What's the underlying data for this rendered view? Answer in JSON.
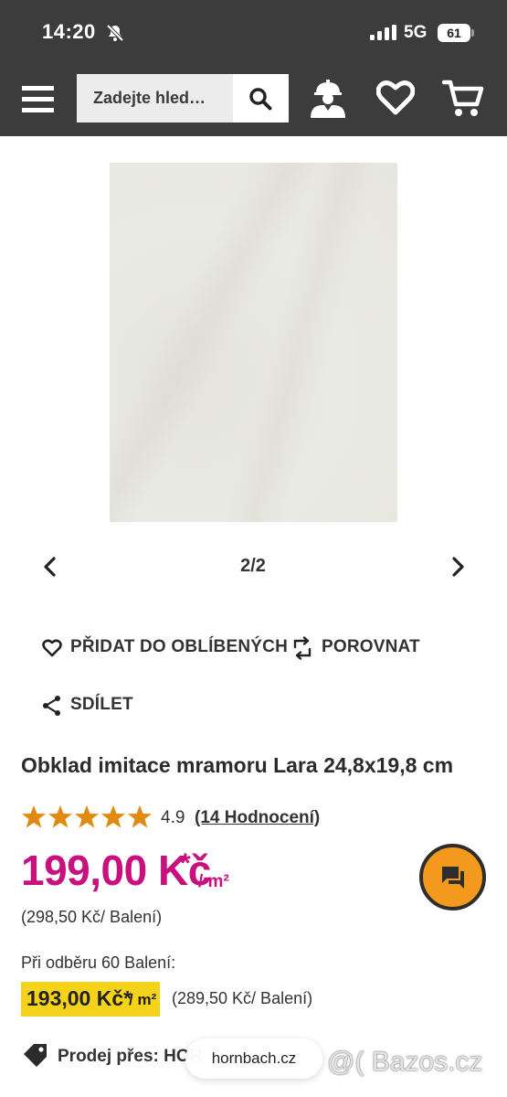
{
  "status_bar": {
    "time": "14:20",
    "network": "5G",
    "battery": "61",
    "icons": [
      "bell-off-icon",
      "signal-icon"
    ]
  },
  "header": {
    "search_placeholder": "Zadejte hled…",
    "icons": [
      "menu-icon",
      "search-icon",
      "user-helmet-icon",
      "heart-icon",
      "cart-icon"
    ]
  },
  "gallery": {
    "counter": "2/2"
  },
  "actions": {
    "favorite_label": "PŘIDAT DO OBLÍBENÝCH",
    "compare_label": "POROVNAT",
    "share_label": "SDÍLET"
  },
  "product": {
    "title": "Obklad imitace mramoru Lara 24,8x19,8 cm",
    "rating": "4.9",
    "rating_count": 4.9,
    "reviews_link": "(14 Hodnocení)",
    "price": "199,00 Kč",
    "price_star": "*",
    "price_unit": "/ m²",
    "price_per_pack": "(298,50 Kč/ Balení)",
    "bulk_label": "Při odběru 60 Balení:",
    "bulk_price": "193,00 Kč*",
    "bulk_unit": "/ m²",
    "bulk_price_per_pack": "(289,50 Kč/ Balení)",
    "seller": "Prodej přes: HOR"
  },
  "browser": {
    "url": "hornbach.cz"
  },
  "watermark": "@( Bazos.cz",
  "colors": {
    "header_bg": "#3c3c3c",
    "price": "#c8117e",
    "star": "#e08a12",
    "highlight": "#f5d31a",
    "chat_button": "#f39a1e"
  }
}
